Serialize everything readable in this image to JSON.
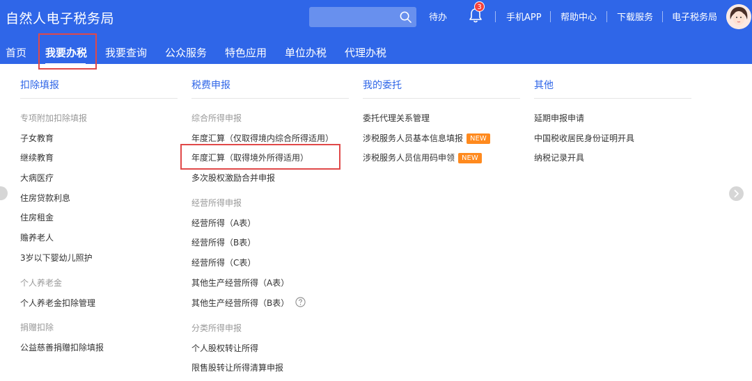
{
  "header": {
    "title": "自然人电子税务局",
    "search_placeholder": "",
    "todo": "待办",
    "bell_count": "3",
    "links": [
      "手机APP",
      "帮助中心",
      "下载服务",
      "电子税务局"
    ]
  },
  "nav": {
    "items": [
      "首页",
      "我要办税",
      "我要查询",
      "公众服务",
      "特色应用",
      "单位办税",
      "代理办税"
    ],
    "active": "我要办税"
  },
  "menu": {
    "deduction": {
      "title": "扣除填报",
      "section_special": "专项附加扣除填报",
      "special_items": [
        "子女教育",
        "继续教育",
        "大病医疗",
        "住房贷款利息",
        "住房租金",
        "赡养老人",
        "3岁以下婴幼儿照护"
      ],
      "section_pension": "个人养老金",
      "pension_item": "个人养老金扣除管理",
      "section_donation": "捐赠扣除",
      "donation_item": "公益慈善捐赠扣除填报"
    },
    "tax_filing": {
      "title": "税费申报",
      "section_comprehensive": "综合所得申报",
      "comprehensive_items": [
        "年度汇算（仅取得境内综合所得适用）",
        "年度汇算（取得境外所得适用）",
        "多次股权激励合并申报"
      ],
      "section_business": "经营所得申报",
      "business_items": [
        "经营所得（A表）",
        "经营所得（B表）",
        "经营所得（C表）",
        "其他生产经营所得（A表）",
        "其他生产经营所得（B表）"
      ],
      "section_classified": "分类所得申报",
      "classified_items": [
        "个人股权转让所得",
        "限售股转让所得清算申报"
      ]
    },
    "entrust": {
      "title": "我的委托",
      "items": [
        "委托代理关系管理",
        "涉税服务人员基本信息填报",
        "涉税服务人员信用码申领"
      ],
      "new_badge": "NEW"
    },
    "other": {
      "title": "其他",
      "items": [
        "延期申报申请",
        "中国税收居民身份证明开具",
        "纳税记录开具"
      ]
    }
  },
  "colors": {
    "brand": "#2f66e8",
    "highlight": "#e04848",
    "new_badge": "#ff8a1e"
  }
}
